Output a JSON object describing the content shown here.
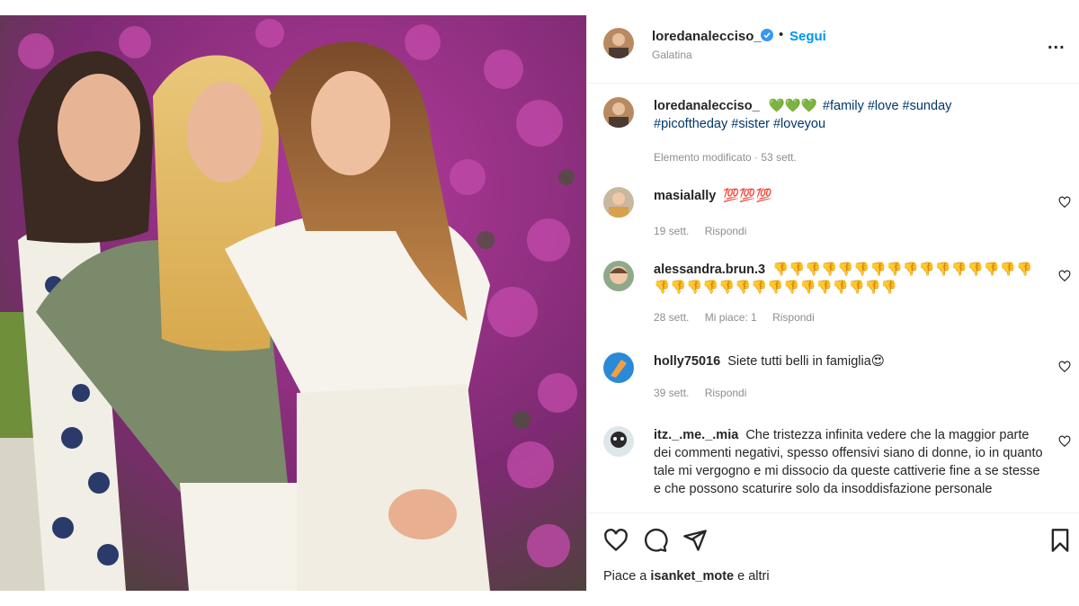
{
  "post": {
    "username": "loredanalecciso_",
    "follow_label": "Segui",
    "separator": "•",
    "location": "Galatina",
    "more_label": "..."
  },
  "caption": {
    "username": "loredanalecciso_",
    "hearts": "💚💚💚",
    "line1": "#family #love #sunday",
    "line2": "#picoftheday #sister #loveyou",
    "meta": "Elemento modificato · 53 sett."
  },
  "comments": [
    {
      "username": "masialally",
      "text": "💯💯💯",
      "time": "19 sett.",
      "likes": "",
      "reply": "Rispondi"
    },
    {
      "username": "alessandra.brun.3",
      "text": "👎👎👎👎👎👎👎👎👎👎👎👎👎👎👎👎👎👎👎👎👎👎👎👎👎👎👎👎👎👎👎",
      "time": "28 sett.",
      "likes": "Mi piace: 1",
      "reply": "Rispondi"
    },
    {
      "username": "holly75016",
      "text": "Siete tutti belli in famiglia😍",
      "time": "39 sett.",
      "likes": "",
      "reply": "Rispondi"
    },
    {
      "username": "itz._.me._.mia",
      "text": "Che tristezza infinita vedere che la maggior parte dei commenti negativi, spesso offensivi siano di donne, io in quanto tale mi vergogno e mi dissocio da queste cattiverie fine a se stesse e che possono scaturire solo da insoddisfazione personale",
      "time": "",
      "likes": "",
      "reply": ""
    }
  ],
  "footer": {
    "likes_prefix": "Piace a",
    "likes_user": "isanket_mote",
    "likes_suffix": "e altri"
  },
  "icons": {
    "heart": "heart-icon",
    "comment": "comment-icon",
    "share": "share-icon",
    "save": "bookmark-icon",
    "verified": "verified-badge-icon"
  },
  "colors": {
    "link_blue": "#0095f6",
    "hashtag": "#00376b",
    "muted": "#8e8e8e",
    "verified": "#3897f0"
  }
}
